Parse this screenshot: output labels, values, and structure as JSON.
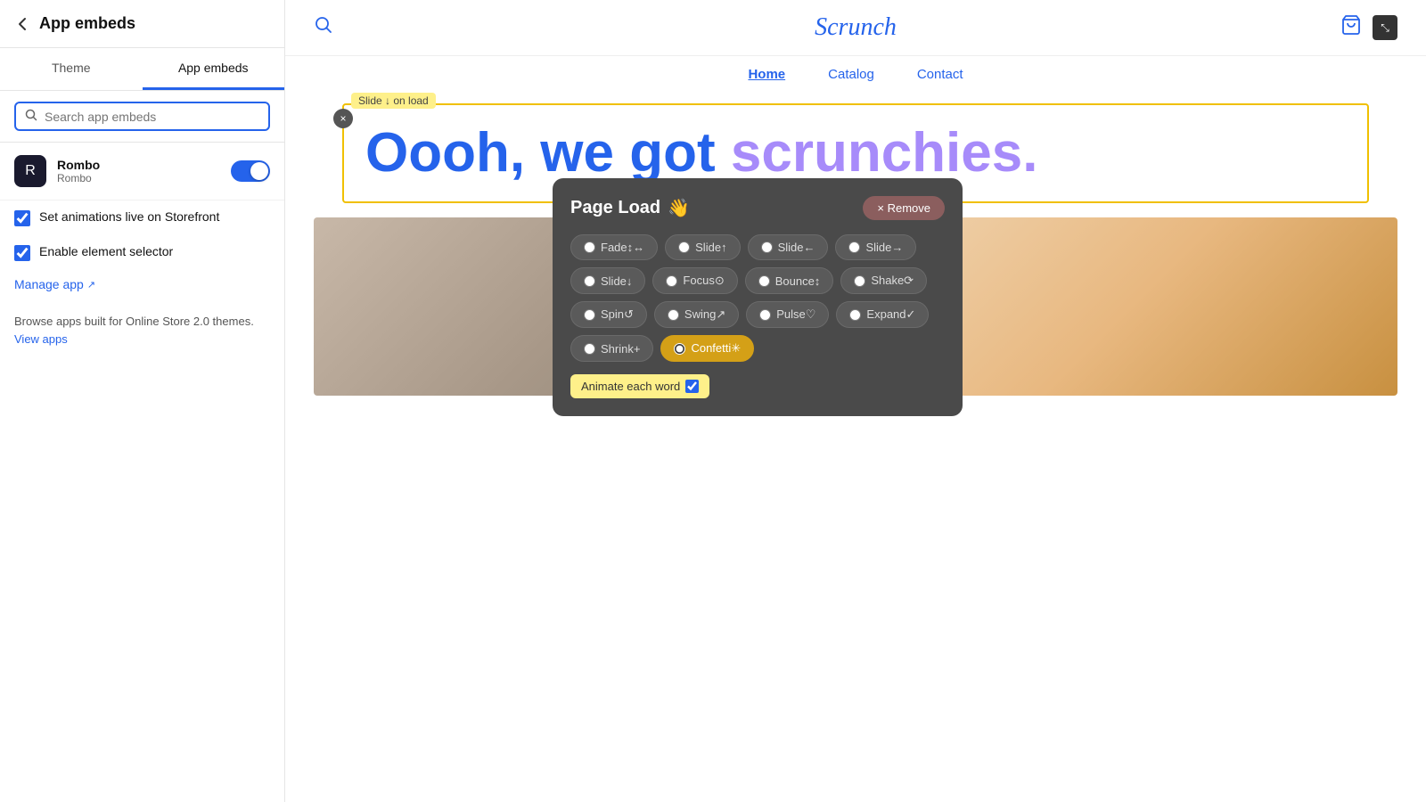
{
  "sidebar": {
    "back_label": "‹",
    "title": "App embeds",
    "tabs": [
      {
        "id": "theme",
        "label": "Theme"
      },
      {
        "id": "app-embeds",
        "label": "App embeds"
      }
    ],
    "search_placeholder": "Search app embeds",
    "app": {
      "name": "Rombo",
      "subtitle": "Rombo",
      "icon_char": "R",
      "toggle_on": true
    },
    "checkboxes": [
      {
        "id": "set-animations",
        "label": "Set animations live on Storefront",
        "checked": true
      },
      {
        "id": "enable-selector",
        "label": "Enable element selector",
        "checked": true
      }
    ],
    "manage_link": "Manage app",
    "browse_text": "Browse apps built for Online Store 2.0 themes.",
    "view_apps_link": "View apps"
  },
  "storefront": {
    "logo": "Scrunch",
    "menu": [
      {
        "label": "Home",
        "active": true
      },
      {
        "label": "Catalog",
        "active": false
      },
      {
        "label": "Contact",
        "active": false
      }
    ],
    "hero_words": [
      "Oooh,",
      "we",
      "got",
      "scrunchies."
    ],
    "slide_tag": "Slide ↓ on load"
  },
  "animation_modal": {
    "title": "Page Load",
    "title_emoji": "👋",
    "remove_label": "× Remove",
    "close_x": "×",
    "options": [
      {
        "label": "Fade↕↔",
        "selected": false
      },
      {
        "label": "Slide↑",
        "selected": false
      },
      {
        "label": "Slide←",
        "selected": false
      },
      {
        "label": "Slide→",
        "selected": false
      },
      {
        "label": "Slide↓",
        "selected": false
      },
      {
        "label": "Focus⊙",
        "selected": false
      },
      {
        "label": "Bounce↕",
        "selected": false
      },
      {
        "label": "Shake⟳",
        "selected": false
      },
      {
        "label": "Spin↺",
        "selected": false
      },
      {
        "label": "Swing↗",
        "selected": false
      },
      {
        "label": "Pulse♡",
        "selected": false
      },
      {
        "label": "Expand✓",
        "selected": false
      },
      {
        "label": "Shrink+",
        "selected": false
      },
      {
        "label": "Confetti✳",
        "selected": true
      }
    ],
    "animate_each_word": {
      "label": "Animate each word",
      "checked": true
    }
  }
}
